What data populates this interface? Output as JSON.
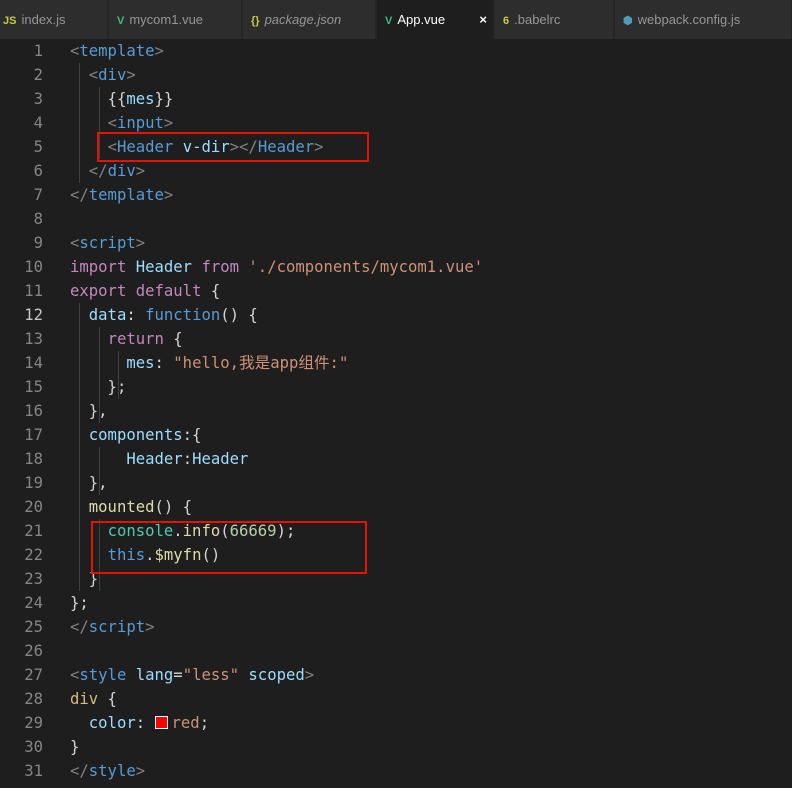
{
  "tabs": [
    {
      "label": "index.js",
      "icon": "JS",
      "icon_color": "#cbcb41",
      "italic": false,
      "active": false
    },
    {
      "label": "mycom1.vue",
      "icon": "V",
      "icon_color": "#41b883",
      "italic": false,
      "active": false
    },
    {
      "label": "package.json",
      "icon": "{}",
      "icon_color": "#cbcb41",
      "italic": true,
      "active": false
    },
    {
      "label": "App.vue",
      "icon": "V",
      "icon_color": "#41b883",
      "italic": false,
      "active": true,
      "close": "×"
    },
    {
      "label": ".babelrc",
      "icon": "6",
      "icon_color": "#cbcb41",
      "italic": false,
      "active": false
    },
    {
      "label": "webpack.config.js",
      "icon": "⬢",
      "icon_color": "#519aba",
      "italic": false,
      "active": false
    }
  ],
  "current_line": 12,
  "lines": [
    [
      {
        "t": "<",
        "c": "br"
      },
      {
        "t": "template",
        "c": "tag"
      },
      {
        "t": ">",
        "c": "br"
      }
    ],
    [
      {
        "t": "  "
      },
      {
        "t": "<",
        "c": "br"
      },
      {
        "t": "div",
        "c": "tag"
      },
      {
        "t": ">",
        "c": "br"
      }
    ],
    [
      {
        "t": "    "
      },
      {
        "t": "{{",
        "c": "plain"
      },
      {
        "t": "mes",
        "c": "var"
      },
      {
        "t": "}}",
        "c": "plain"
      }
    ],
    [
      {
        "t": "    "
      },
      {
        "t": "<",
        "c": "br"
      },
      {
        "t": "input",
        "c": "tag"
      },
      {
        "t": ">",
        "c": "br"
      }
    ],
    [
      {
        "t": "    "
      },
      {
        "t": "<",
        "c": "br"
      },
      {
        "t": "Header",
        "c": "tag"
      },
      {
        "t": " "
      },
      {
        "t": "v-dir",
        "c": "attr"
      },
      {
        "t": "></",
        "c": "br"
      },
      {
        "t": "Header",
        "c": "tag"
      },
      {
        "t": ">",
        "c": "br"
      }
    ],
    [
      {
        "t": "  "
      },
      {
        "t": "</",
        "c": "br"
      },
      {
        "t": "div",
        "c": "tag"
      },
      {
        "t": ">",
        "c": "br"
      }
    ],
    [
      {
        "t": "</",
        "c": "br"
      },
      {
        "t": "template",
        "c": "tag"
      },
      {
        "t": ">",
        "c": "br"
      }
    ],
    [],
    [
      {
        "t": "<",
        "c": "br"
      },
      {
        "t": "script",
        "c": "tag"
      },
      {
        "t": ">",
        "c": "br"
      }
    ],
    [
      {
        "t": "import",
        "c": "kw"
      },
      {
        "t": " "
      },
      {
        "t": "Header",
        "c": "var"
      },
      {
        "t": " "
      },
      {
        "t": "from",
        "c": "kw"
      },
      {
        "t": " "
      },
      {
        "t": "'./components/mycom1.vue'",
        "c": "str"
      }
    ],
    [
      {
        "t": "export",
        "c": "kw"
      },
      {
        "t": " "
      },
      {
        "t": "default",
        "c": "kw"
      },
      {
        "t": " {",
        "c": "plain"
      }
    ],
    [
      {
        "t": "  "
      },
      {
        "t": "data",
        "c": "var"
      },
      {
        "t": ": ",
        "c": "plain"
      },
      {
        "t": "function",
        "c": "blue"
      },
      {
        "t": "() {",
        "c": "plain"
      }
    ],
    [
      {
        "t": "    "
      },
      {
        "t": "return",
        "c": "kw"
      },
      {
        "t": " {",
        "c": "plain"
      }
    ],
    [
      {
        "t": "      "
      },
      {
        "t": "mes",
        "c": "var"
      },
      {
        "t": ": ",
        "c": "plain"
      },
      {
        "t": "\"hello,我是app组件:\"",
        "c": "str"
      }
    ],
    [
      {
        "t": "    };",
        "c": "plain"
      }
    ],
    [
      {
        "t": "  },",
        "c": "plain"
      }
    ],
    [
      {
        "t": "  "
      },
      {
        "t": "components",
        "c": "var"
      },
      {
        "t": ":{",
        "c": "plain"
      }
    ],
    [
      {
        "t": "      "
      },
      {
        "t": "Header",
        "c": "var"
      },
      {
        "t": ":",
        "c": "plain"
      },
      {
        "t": "Header",
        "c": "var"
      }
    ],
    [
      {
        "t": "  },",
        "c": "plain"
      }
    ],
    [
      {
        "t": "  "
      },
      {
        "t": "mounted",
        "c": "fn"
      },
      {
        "t": "() {",
        "c": "plain"
      }
    ],
    [
      {
        "t": "    "
      },
      {
        "t": "console",
        "c": "cls"
      },
      {
        "t": ".",
        "c": "plain"
      },
      {
        "t": "info",
        "c": "fn"
      },
      {
        "t": "(",
        "c": "plain"
      },
      {
        "t": "66669",
        "c": "num"
      },
      {
        "t": ");",
        "c": "plain"
      }
    ],
    [
      {
        "t": "    "
      },
      {
        "t": "this",
        "c": "blue"
      },
      {
        "t": ".",
        "c": "plain"
      },
      {
        "t": "$myfn",
        "c": "fn"
      },
      {
        "t": "()",
        "c": "plain"
      }
    ],
    [
      {
        "t": "  }",
        "c": "plain"
      }
    ],
    [
      {
        "t": "};",
        "c": "plain"
      }
    ],
    [
      {
        "t": "</",
        "c": "br"
      },
      {
        "t": "script",
        "c": "tag"
      },
      {
        "t": ">",
        "c": "br"
      }
    ],
    [],
    [
      {
        "t": "<",
        "c": "br"
      },
      {
        "t": "style",
        "c": "tag"
      },
      {
        "t": " "
      },
      {
        "t": "lang",
        "c": "attr"
      },
      {
        "t": "=",
        "c": "plain"
      },
      {
        "t": "\"less\"",
        "c": "str"
      },
      {
        "t": " "
      },
      {
        "t": "scoped",
        "c": "attr"
      },
      {
        "t": ">",
        "c": "br"
      }
    ],
    [
      {
        "t": "div",
        "c": "sel"
      },
      {
        "t": " {",
        "c": "plain"
      }
    ],
    [
      {
        "t": "  "
      },
      {
        "t": "color",
        "c": "var"
      },
      {
        "t": ": ",
        "c": "plain"
      },
      {
        "t": "",
        "c": "swatch"
      },
      {
        "t": "red",
        "c": "str"
      },
      {
        "t": ";",
        "c": "plain"
      }
    ],
    [
      {
        "t": "}",
        "c": "plain"
      }
    ],
    [
      {
        "t": "</",
        "c": "br"
      },
      {
        "t": "style",
        "c": "tag"
      },
      {
        "t": ">",
        "c": "br"
      }
    ]
  ],
  "swatch_color": "#ff0000",
  "highlight_color": "#e51400"
}
